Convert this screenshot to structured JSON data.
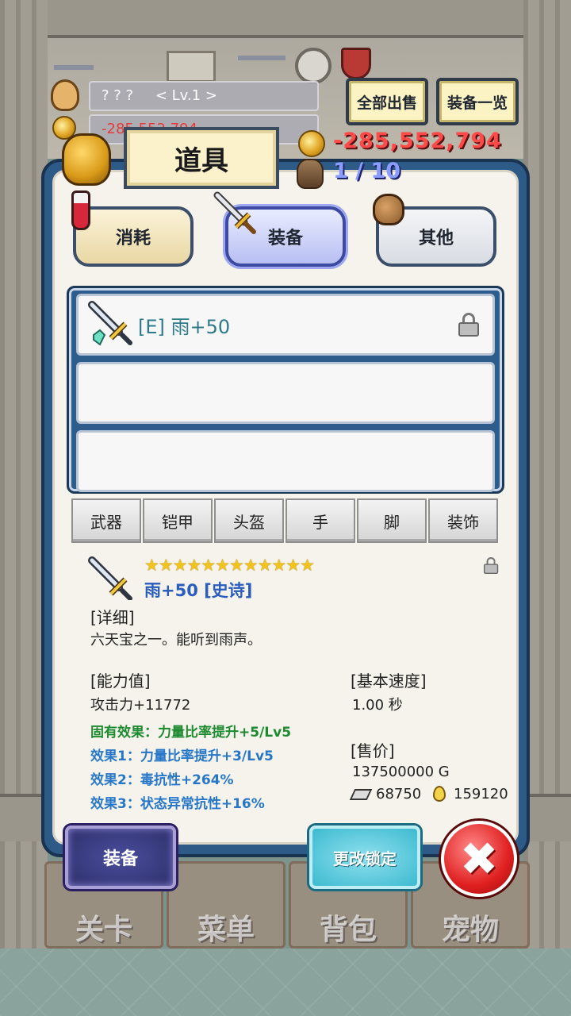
{
  "hud": {
    "player_name": "? ? ?",
    "level": "< Lv.1 >",
    "money_bg": "-285,552,794",
    "sell_all": "全部出售",
    "equipment_list": "装备一览",
    "gold": "-285,552,794",
    "bag_capacity": "1 / 10"
  },
  "panel": {
    "title": "道具",
    "categories": [
      {
        "label": "消耗",
        "icon": "potion-icon"
      },
      {
        "label": "装备",
        "icon": "sword-icon"
      },
      {
        "label": "其他",
        "icon": "pouch-icon"
      }
    ],
    "items": [
      {
        "name": "[E] 雨+50",
        "locked": true
      },
      {
        "name": ""
      },
      {
        "name": ""
      }
    ],
    "sub_tabs": [
      "武器",
      "铠甲",
      "头盔",
      "手",
      "脚",
      "装饰"
    ]
  },
  "detail": {
    "stars": "★★★★★★★★★★★★",
    "star_count": 12,
    "name": "雨+50 [史诗]",
    "detail_label": "[详细]",
    "description": "六天宝之一。能听到雨声。",
    "stats_label": "[能力值]",
    "attack": "攻击力+11772",
    "inherent": "固有效果：力量比率提升+5/Lv5",
    "effect1": "效果1：力量比率提升+3/Lv5",
    "effect2": "效果2：毒抗性+264%",
    "effect3": "效果3：状态异常抗性+16%",
    "speed_label": "[基本速度]",
    "speed": "1.00 秒",
    "price_label": "[售价]",
    "price": "137500000 G",
    "stone_value": "68750",
    "drop_value": "159120"
  },
  "buttons": {
    "equip": "装备",
    "change_lock": "更改锁定",
    "close": "✖"
  },
  "nav": [
    "关卡",
    "菜单",
    "背包",
    "宠物"
  ],
  "colors": {
    "panel_blue": "#2d5a86",
    "gold_red": "#ff4a4a",
    "bag_blue": "#8b9cff",
    "epic_blue": "#2a5dbd",
    "inherent_green": "#1c8a2e",
    "effect_blue": "#2777c9"
  }
}
